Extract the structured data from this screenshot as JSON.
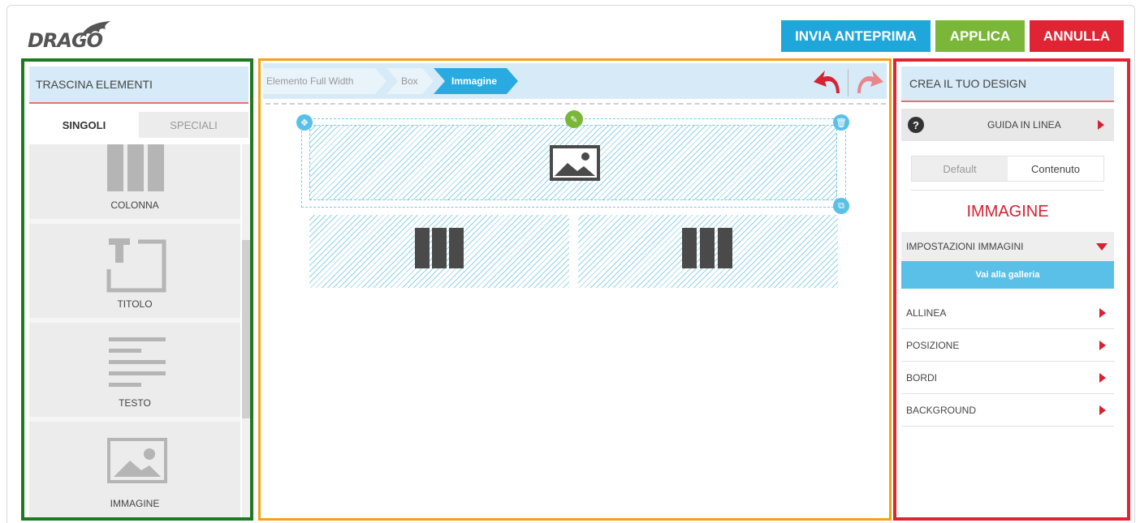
{
  "header": {
    "logo_text": "DRAGO",
    "buttons": {
      "preview": "INVIA ANTEPRIMA",
      "apply": "APPLICA",
      "cancel": "ANNULLA"
    },
    "colors": {
      "preview": "#1fa6db",
      "apply": "#7ab738",
      "cancel": "#e12433"
    }
  },
  "left_panel": {
    "title": "TRASCINA ELEMENTI",
    "tabs": [
      {
        "label": "SINGOLI",
        "active": true
      },
      {
        "label": "SPECIALI",
        "active": false
      }
    ],
    "elements": [
      {
        "label": "COLONNA",
        "icon": "columns-icon"
      },
      {
        "label": "TITOLO",
        "icon": "title-icon"
      },
      {
        "label": "TESTO",
        "icon": "text-icon"
      },
      {
        "label": "IMMAGINE",
        "icon": "image-icon"
      }
    ]
  },
  "canvas": {
    "breadcrumb": [
      "Elemento Full Width",
      "Box",
      "Immagine"
    ],
    "active_crumb": "Immagine",
    "undo_icon": "undo-icon",
    "redo_icon": "redo-icon"
  },
  "right_panel": {
    "title": "CREA IL TUO DESIGN",
    "guide_label": "GUIDA IN LINEA",
    "tabs": [
      {
        "label": "Default",
        "active": false
      },
      {
        "label": "Contenuto",
        "active": true
      }
    ],
    "element_title": "IMMAGINE",
    "settings_section": "IMPOSTAZIONI IMMAGINI",
    "gallery_button": "Vai alla galleria",
    "properties": [
      "ALLINEA",
      "POSIZIONE",
      "BORDI",
      "BACKGROUND"
    ]
  }
}
